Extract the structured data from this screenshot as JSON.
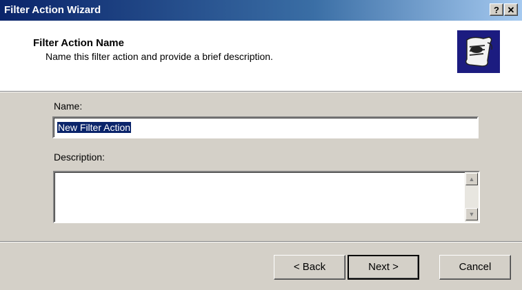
{
  "window": {
    "title": "Filter Action Wizard",
    "help_label": "?",
    "close_label": "✕"
  },
  "header": {
    "title": "Filter Action Name",
    "subtitle": "Name this filter action and provide a brief description.",
    "icon": "wizard-scroll-icon"
  },
  "form": {
    "name_label": "Name:",
    "name_value": "New Filter Action",
    "description_label": "Description:",
    "description_value": ""
  },
  "buttons": {
    "back": "< Back",
    "next": "Next >",
    "cancel": "Cancel"
  },
  "colors": {
    "titlebar": "#0a246a",
    "face": "#d4d0c8",
    "selection": "#0a246a"
  }
}
